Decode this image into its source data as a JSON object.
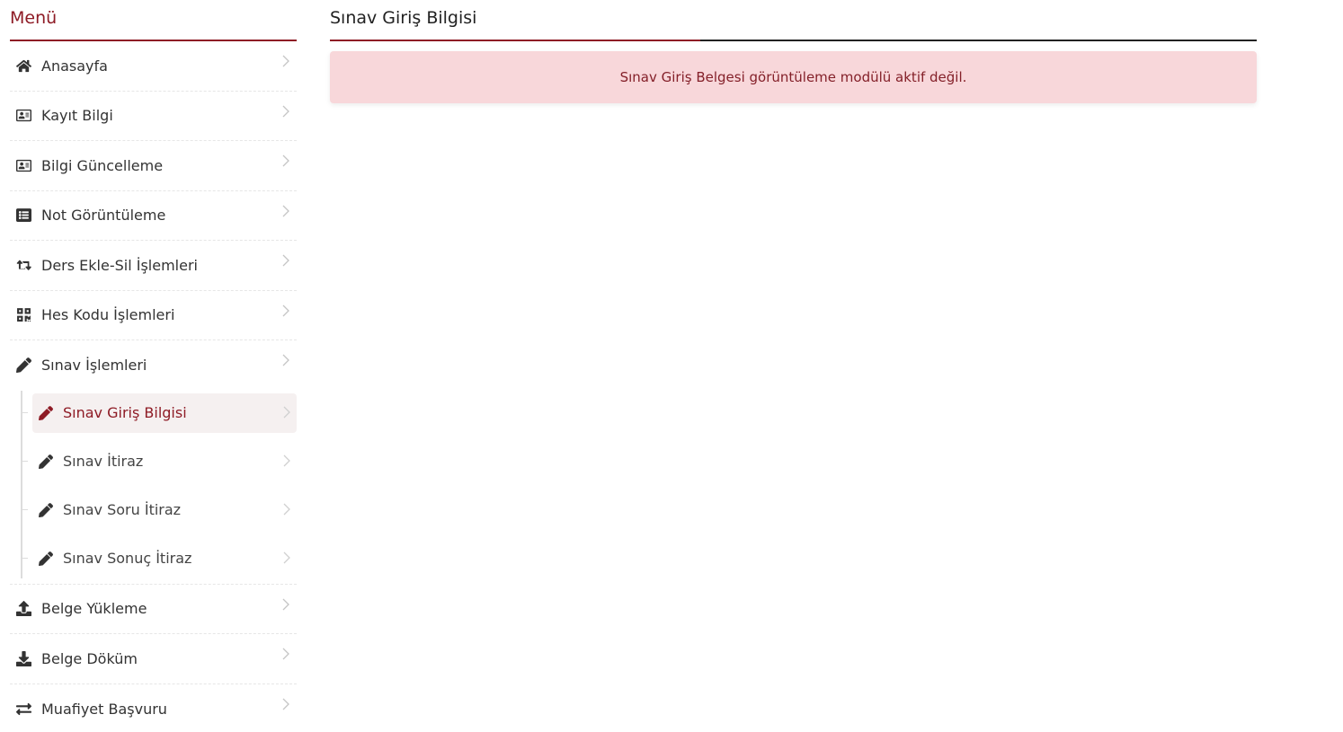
{
  "sidebar": {
    "title": "Menü",
    "items": [
      {
        "label": "Anasayfa",
        "icon": "home-icon"
      },
      {
        "label": "Kayıt Bilgi",
        "icon": "id-card-icon"
      },
      {
        "label": "Bilgi Güncelleme",
        "icon": "id-card-icon"
      },
      {
        "label": "Not Görüntüleme",
        "icon": "list-icon"
      },
      {
        "label": "Ders Ekle-Sil İşlemleri",
        "icon": "retweet-icon"
      },
      {
        "label": "Hes Kodu İşlemleri",
        "icon": "qrcode-icon"
      },
      {
        "label": "Sınav İşlemleri",
        "icon": "pencil-icon"
      }
    ],
    "subitems": [
      {
        "label": "Sınav Giriş Bilgisi",
        "icon": "pencil-icon",
        "active": true
      },
      {
        "label": "Sınav İtiraz",
        "icon": "pencil-icon"
      },
      {
        "label": "Sınav Soru İtiraz",
        "icon": "pencil-icon"
      },
      {
        "label": "Sınav Sonuç İtiraz",
        "icon": "pencil-icon"
      }
    ],
    "items_after": [
      {
        "label": "Belge Yükleme",
        "icon": "upload-icon"
      },
      {
        "label": "Belge Döküm",
        "icon": "download-icon"
      },
      {
        "label": "Muafiyet Başvuru",
        "icon": "exchange-icon"
      }
    ]
  },
  "main": {
    "title": "Sınav Giriş Bilgisi",
    "alert": "Sınav Giriş Belgesi görüntüleme modülü aktif değil."
  },
  "colors": {
    "accent": "#8e1b25",
    "alert_bg": "#f8d7da",
    "alert_text": "#842029"
  }
}
